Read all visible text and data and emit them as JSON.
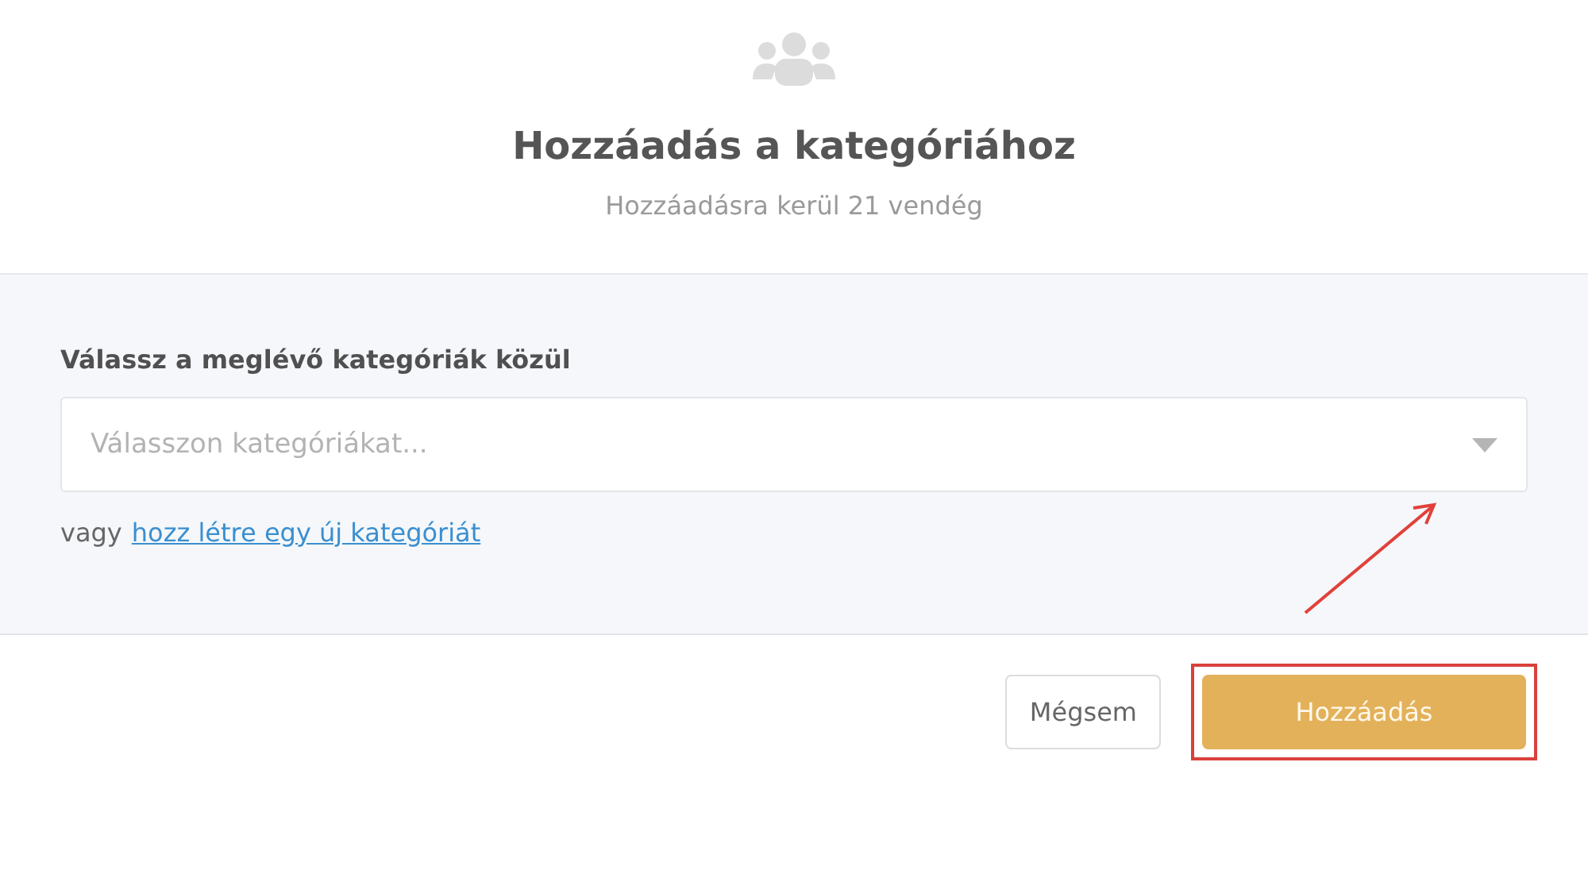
{
  "header": {
    "title": "Hozzáadás a kategóriához",
    "subtitle": "Hozzáadásra kerül 21 vendég"
  },
  "form": {
    "label": "Válassz a meglévő kategóriák közül",
    "select": {
      "placeholder": "Válasszon kategóriákat..."
    },
    "alt_prefix": "vagy",
    "alt_link": "hozz létre egy új kategóriát"
  },
  "buttons": [
    {
      "label": "Mégsem",
      "kind": "secondary",
      "highlighted": false
    },
    {
      "label": "Hozzáadás",
      "kind": "primary",
      "highlighted": true
    }
  ]
}
